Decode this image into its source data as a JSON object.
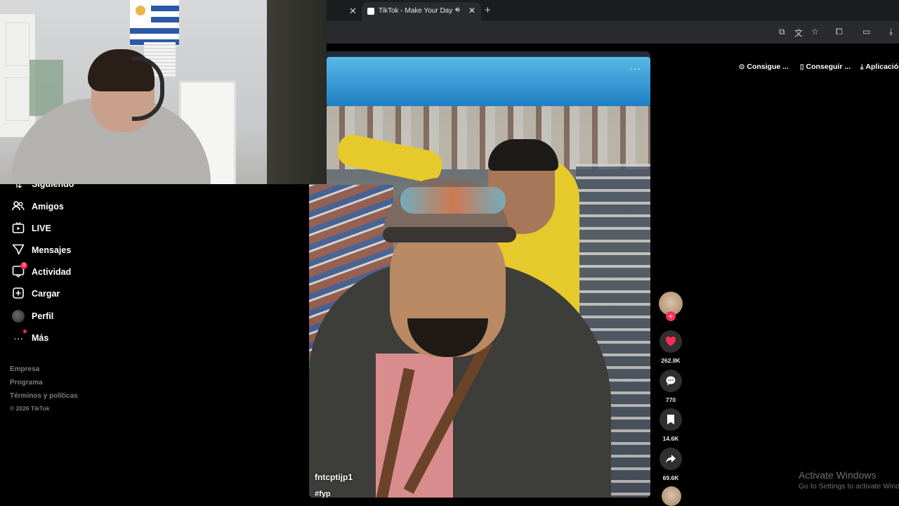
{
  "browser": {
    "tab_title": "TikTok - Make Your Day",
    "icons": {
      "close_prev_tab": "close-icon",
      "audio": "speaker-icon",
      "close_tab": "close-icon",
      "new_tab": "plus-icon",
      "install": "install-app-icon",
      "translate": "translate-icon",
      "bookmark": "star-icon",
      "extensions": "puzzle-icon",
      "sidepanel": "cast-icon",
      "download": "download-icon"
    }
  },
  "sidebar": {
    "partial_item": "Siguiendo",
    "items": [
      {
        "label": "Amigos",
        "icon": "friends-icon"
      },
      {
        "label": "LIVE",
        "icon": "live-tv-icon"
      },
      {
        "label": "Mensajes",
        "icon": "send-icon"
      },
      {
        "label": "Actividad",
        "icon": "activity-icon",
        "badge": "3"
      },
      {
        "label": "Cargar",
        "icon": "upload-plus-icon"
      },
      {
        "label": "Perfil",
        "icon": "avatar"
      },
      {
        "label": "Más",
        "icon": "more-dots-icon"
      }
    ],
    "footer": [
      "Empresa",
      "Programa",
      "Términos y políticas"
    ],
    "copyright": "© 2026 TikTok"
  },
  "video": {
    "author": "fntcptijp1",
    "hashtag": "#fyp",
    "more": "···"
  },
  "actions": {
    "likes": "262.8K",
    "comments": "770",
    "saves": "14.6K",
    "shares": "69.6K",
    "like_color": "#fe2c55"
  },
  "top_buttons": [
    "Consigue ...",
    "Conseguir ...",
    "Aplicación"
  ],
  "watermark": {
    "title": "Activate Windows",
    "subtitle": "Go to Settings to activate Windows."
  }
}
